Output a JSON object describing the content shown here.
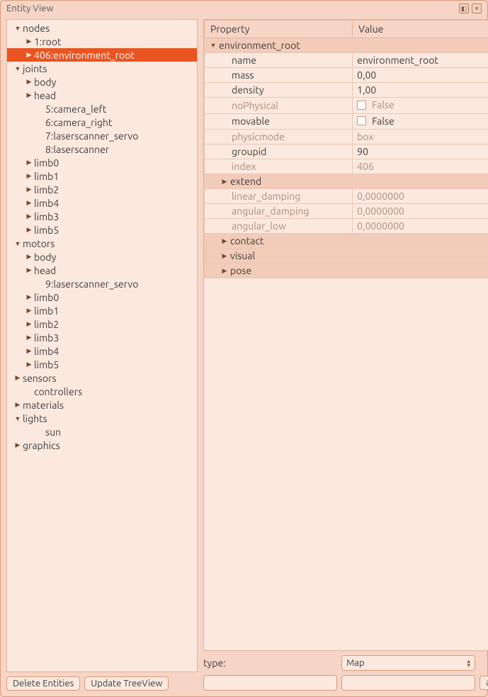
{
  "window": {
    "title": "Entity View"
  },
  "tree": [
    {
      "label": "nodes",
      "indent": 0,
      "arrow": "down"
    },
    {
      "label": "1:root",
      "indent": 1,
      "arrow": "right"
    },
    {
      "label": "406:environment_root",
      "indent": 1,
      "arrow": "right",
      "selected": true
    },
    {
      "label": "joints",
      "indent": 0,
      "arrow": "down"
    },
    {
      "label": "body",
      "indent": 1,
      "arrow": "right"
    },
    {
      "label": "head",
      "indent": 1,
      "arrow": "right"
    },
    {
      "label": "5:camera_left",
      "indent": 2,
      "arrow": "none"
    },
    {
      "label": "6:camera_right",
      "indent": 2,
      "arrow": "none"
    },
    {
      "label": "7:laserscanner_servo",
      "indent": 2,
      "arrow": "none"
    },
    {
      "label": "8:laserscanner",
      "indent": 2,
      "arrow": "none"
    },
    {
      "label": "limb0",
      "indent": 1,
      "arrow": "right"
    },
    {
      "label": "limb1",
      "indent": 1,
      "arrow": "right"
    },
    {
      "label": "limb2",
      "indent": 1,
      "arrow": "right"
    },
    {
      "label": "limb4",
      "indent": 1,
      "arrow": "right"
    },
    {
      "label": "limb3",
      "indent": 1,
      "arrow": "right"
    },
    {
      "label": "limb5",
      "indent": 1,
      "arrow": "right"
    },
    {
      "label": "motors",
      "indent": 0,
      "arrow": "down"
    },
    {
      "label": "body",
      "indent": 1,
      "arrow": "right"
    },
    {
      "label": "head",
      "indent": 1,
      "arrow": "right"
    },
    {
      "label": "9:laserscanner_servo",
      "indent": 2,
      "arrow": "none"
    },
    {
      "label": "limb0",
      "indent": 1,
      "arrow": "right"
    },
    {
      "label": "limb1",
      "indent": 1,
      "arrow": "right"
    },
    {
      "label": "limb2",
      "indent": 1,
      "arrow": "right"
    },
    {
      "label": "limb3",
      "indent": 1,
      "arrow": "right"
    },
    {
      "label": "limb4",
      "indent": 1,
      "arrow": "right"
    },
    {
      "label": "limb5",
      "indent": 1,
      "arrow": "right"
    },
    {
      "label": "sensors",
      "indent": 0,
      "arrow": "right"
    },
    {
      "label": "controllers",
      "indent": 1,
      "arrow": "none"
    },
    {
      "label": "materials",
      "indent": 0,
      "arrow": "right"
    },
    {
      "label": "lights",
      "indent": 0,
      "arrow": "down"
    },
    {
      "label": "sun",
      "indent": 2,
      "arrow": "none"
    },
    {
      "label": "graphics",
      "indent": 0,
      "arrow": "right"
    }
  ],
  "buttons": {
    "delete": "Delete Entities",
    "update": "Update TreeView",
    "add": "add"
  },
  "propHeaders": {
    "property": "Property",
    "value": "Value"
  },
  "props": [
    {
      "type": "group",
      "name": "environment_root",
      "arrow": "down"
    },
    {
      "type": "prop",
      "name": "name",
      "value": "environment_root",
      "indent": 2
    },
    {
      "type": "prop",
      "name": "mass",
      "value": "0,00",
      "indent": 2
    },
    {
      "type": "prop",
      "name": "density",
      "value": "1,00",
      "indent": 2
    },
    {
      "type": "prop",
      "name": "noPhysical",
      "value": "False",
      "indent": 2,
      "disabled": true,
      "checkbox": true
    },
    {
      "type": "prop",
      "name": "movable",
      "value": "False",
      "indent": 2,
      "checkbox": true
    },
    {
      "type": "prop",
      "name": "physicmode",
      "value": "box",
      "indent": 2,
      "disabled": true
    },
    {
      "type": "prop",
      "name": "groupid",
      "value": "90",
      "indent": 2
    },
    {
      "type": "prop",
      "name": "index",
      "value": "406",
      "indent": 2,
      "disabled": true
    },
    {
      "type": "group",
      "name": "extend",
      "arrow": "right",
      "indent": 1
    },
    {
      "type": "prop",
      "name": "linear_damping",
      "value": "0,0000000",
      "indent": 2,
      "disabled": true
    },
    {
      "type": "prop",
      "name": "angular_damping",
      "value": "0,0000000",
      "indent": 2,
      "disabled": true
    },
    {
      "type": "prop",
      "name": "angular_low",
      "value": "0,0000000",
      "indent": 2,
      "disabled": true
    },
    {
      "type": "group",
      "name": "contact",
      "arrow": "right",
      "indent": 1
    },
    {
      "type": "group",
      "name": "visual",
      "arrow": "right",
      "indent": 1
    },
    {
      "type": "group",
      "name": "pose",
      "arrow": "right",
      "indent": 1
    }
  ],
  "typeForm": {
    "label": "type:",
    "selected": "Map"
  }
}
